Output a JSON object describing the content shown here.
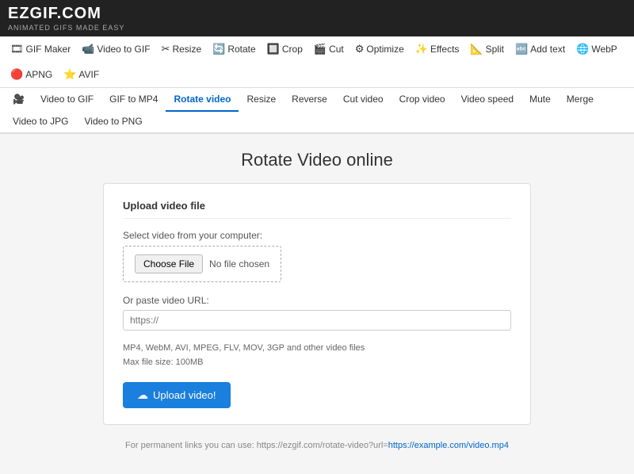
{
  "logo": {
    "ez": "EZGIF",
    "com": ".COM",
    "tagline": "ANIMATED GIFS MADE EASY"
  },
  "main_nav": {
    "items": [
      {
        "id": "gif-maker",
        "icon": "🎞",
        "label": "GIF Maker"
      },
      {
        "id": "video-to-gif",
        "icon": "📹",
        "label": "Video to GIF"
      },
      {
        "id": "resize",
        "icon": "✂",
        "label": "Resize"
      },
      {
        "id": "rotate",
        "icon": "🔄",
        "label": "Rotate"
      },
      {
        "id": "crop",
        "icon": "🔲",
        "label": "Crop"
      },
      {
        "id": "cut",
        "icon": "🎬",
        "label": "Cut"
      },
      {
        "id": "optimize",
        "icon": "⚙",
        "label": "Optimize"
      },
      {
        "id": "effects",
        "icon": "✨",
        "label": "Effects"
      },
      {
        "id": "split",
        "icon": "📐",
        "label": "Split"
      },
      {
        "id": "add-text",
        "icon": "🔤",
        "label": "Add text"
      },
      {
        "id": "webp",
        "icon": "🌐",
        "label": "WebP"
      },
      {
        "id": "apng",
        "icon": "🔴",
        "label": "APNG"
      },
      {
        "id": "avif",
        "icon": "⭐",
        "label": "AVIF"
      }
    ]
  },
  "sub_nav": {
    "items": [
      {
        "id": "video-icon",
        "icon": "🎥",
        "label": ""
      },
      {
        "id": "video-to-gif",
        "label": "Video to GIF"
      },
      {
        "id": "gif-to-mp4",
        "label": "GIF to MP4"
      },
      {
        "id": "rotate-video",
        "label": "Rotate video",
        "active": true
      },
      {
        "id": "resize",
        "label": "Resize"
      },
      {
        "id": "reverse",
        "label": "Reverse"
      },
      {
        "id": "cut-video",
        "label": "Cut video"
      },
      {
        "id": "crop-video",
        "label": "Crop video"
      },
      {
        "id": "video-speed",
        "label": "Video speed"
      },
      {
        "id": "mute",
        "label": "Mute"
      },
      {
        "id": "merge",
        "label": "Merge"
      },
      {
        "id": "video-to-jpg",
        "label": "Video to JPG"
      },
      {
        "id": "video-to-png",
        "label": "Video to PNG"
      }
    ]
  },
  "page": {
    "title": "Rotate Video online"
  },
  "upload_card": {
    "heading": "Upload video file",
    "select_label": "Select video from your computer:",
    "choose_file_btn": "Choose File",
    "no_file_text": "No file chosen",
    "url_label": "Or paste video URL:",
    "url_placeholder": "https://",
    "formats_line1": "MP4, WebM, AVI, MPEG, FLV, MOV, 3GP and other video files",
    "formats_line2": "Max file size: 100MB",
    "upload_btn": "Upload video!"
  },
  "footer": {
    "text": "For permanent links you can use: https://ezgif.com/rotate-video?url=",
    "link_text": "https://example.com/video.mp4",
    "link_href": "https://example.com/video.mp4"
  }
}
